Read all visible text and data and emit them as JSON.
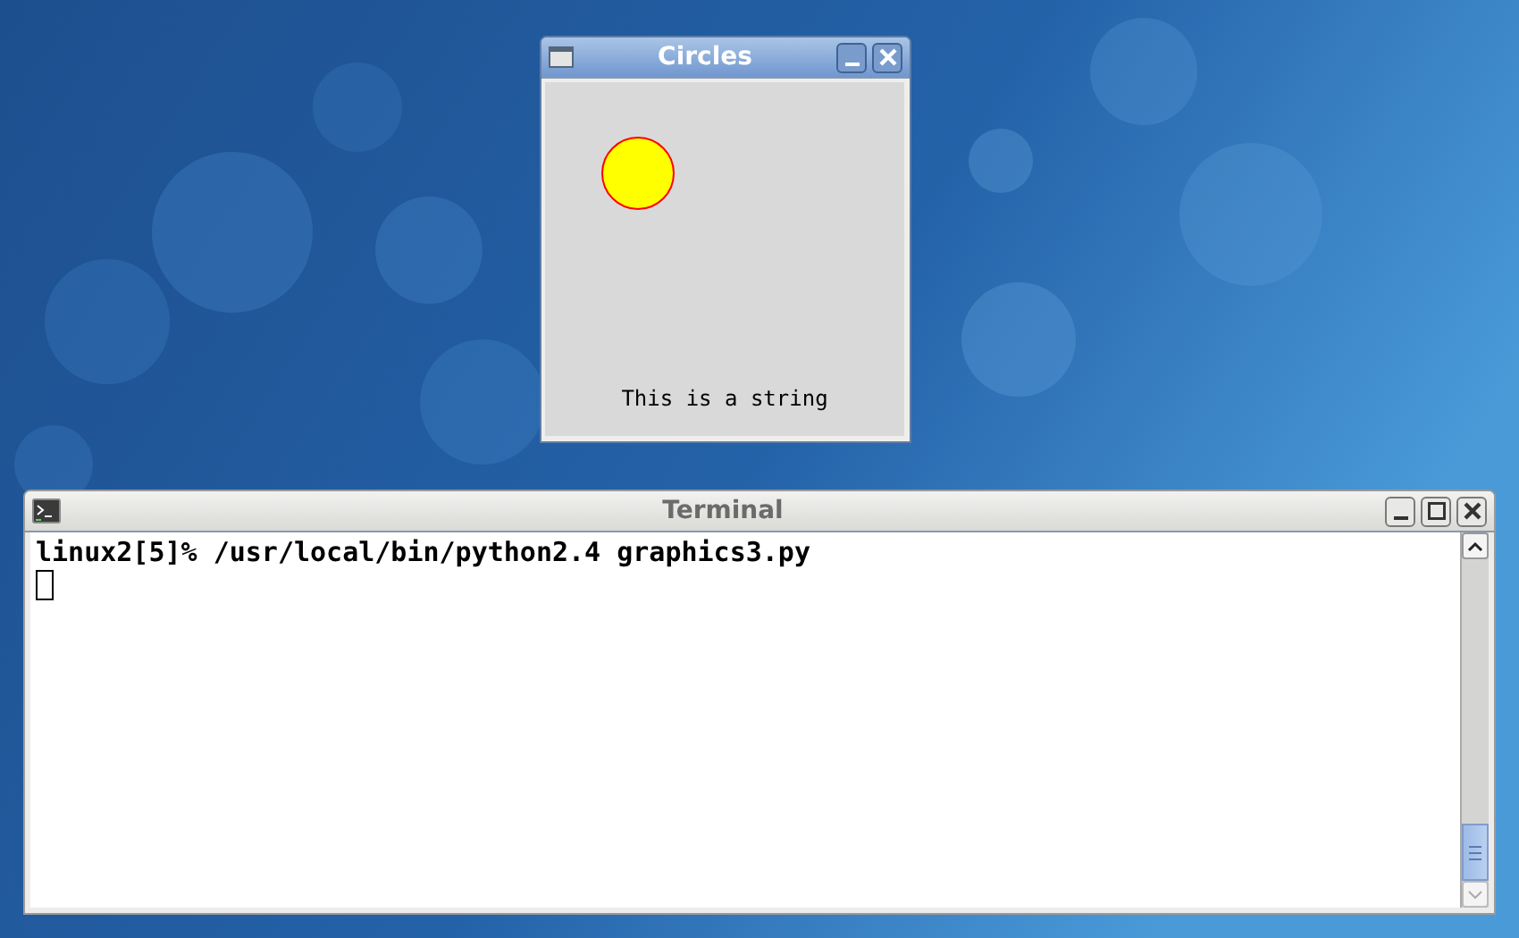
{
  "windows": [
    {
      "kind": "graphics",
      "title": "Circles",
      "focused": true,
      "label": "This is a string"
    },
    {
      "kind": "terminal",
      "title": "Terminal",
      "focused": false,
      "lines": [
        "linux2[5]% /usr/local/bin/python2.4 graphics3.py"
      ]
    }
  ]
}
